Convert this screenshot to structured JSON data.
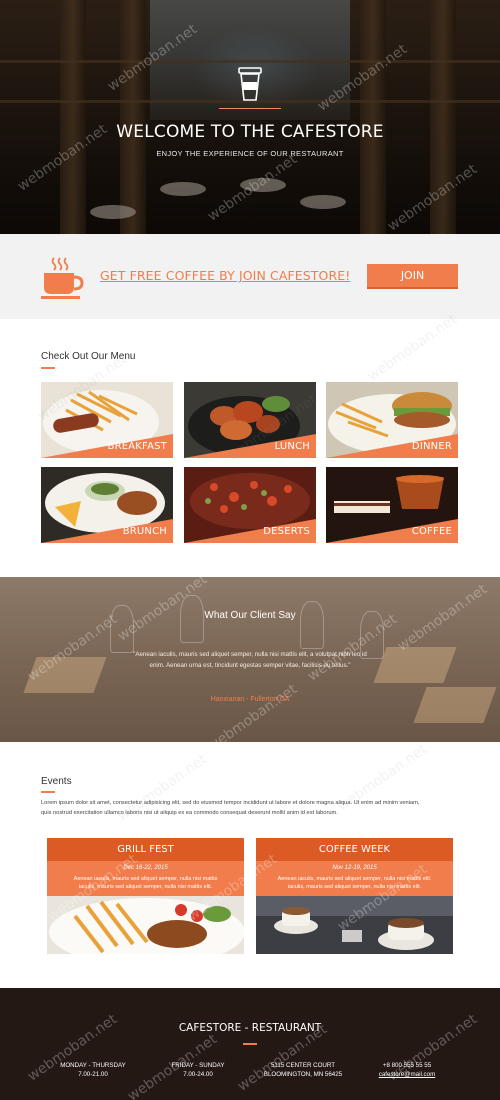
{
  "hero": {
    "title": "WELCOME TO THE CAFESTORE",
    "subtitle": "ENJOY THE EXPERIENCE OF OUR RESTAURANT"
  },
  "promo": {
    "text": "GET FREE COFFEE BY JOIN CAFESTORE!",
    "button": "JOIN"
  },
  "menu": {
    "title": "Check Out Our Menu",
    "items": [
      {
        "label": "BREAKFAST"
      },
      {
        "label": "LUNCH"
      },
      {
        "label": "DINNER"
      },
      {
        "label": "BRUNCH"
      },
      {
        "label": "DESERTS"
      },
      {
        "label": "COFFEE"
      }
    ]
  },
  "testimonial": {
    "title": "What Our Client Say",
    "quote_line1": "\"Aenean iaculis, mauris sed aliquet semper, nulla nisi mattis elit, a volutpat nibh leo id",
    "quote_line2": "enim. Aenean urna est, tincidunt egestas semper vitae, facilisis eu tellus.\"",
    "author": "Hanxianan - Fullerton CA"
  },
  "events": {
    "title": "Events",
    "desc_line1": "Lorem ipsum dolor sit amet, consectetur adipisicing elit, sed do eiusmod tempor incididunt ut labore et dolore magna aliqua. Ut enim ad minim veniam,",
    "desc_line2": "quis nostrud exercitation ullamco laboris nisi ut aliquip ex ea commodo consequat deserunt mollit anim id est laborum.",
    "items": [
      {
        "title": "GRILL FEST",
        "date": "Dec 16-22, 2015",
        "desc_line1": "Aenean iaculis, mauris sed aliquet semper, nulla nisi mattis",
        "desc_line2": "iaculis, mauris sed aliquet semper, nulla nisi mattis elit."
      },
      {
        "title": "COFFEE WEEK",
        "date": "Nov 12-19, 2015",
        "desc_line1": "Aenean iaculis, mauris sed aliquet semper, nulla nisi mattis elit.",
        "desc_line2": "iaculis, mauris sed aliquet semper, nulla nisi mattis elit."
      }
    ]
  },
  "footer": {
    "title": "CAFESTORE - RESTAURANT",
    "col1": {
      "line1": "MONDAY - THURSDAY",
      "line2": "7.00-21.00"
    },
    "col2": {
      "line1": "FRIDAY - SUNDAY",
      "line2": "7.00-24.00"
    },
    "col3": {
      "line1": "5115 CENTER COURT",
      "line2": "BLOOMINGTON, MN 56425"
    },
    "col4": {
      "line1": "+8 800 555 55 55",
      "line2": "cafestore@mail.com"
    }
  },
  "watermark": "webmoban.net",
  "colors": {
    "accent": "#f07d4b",
    "accent_dark": "#dc5a24",
    "footer_bg": "#231814",
    "promo_bg": "#f2f2f2"
  }
}
